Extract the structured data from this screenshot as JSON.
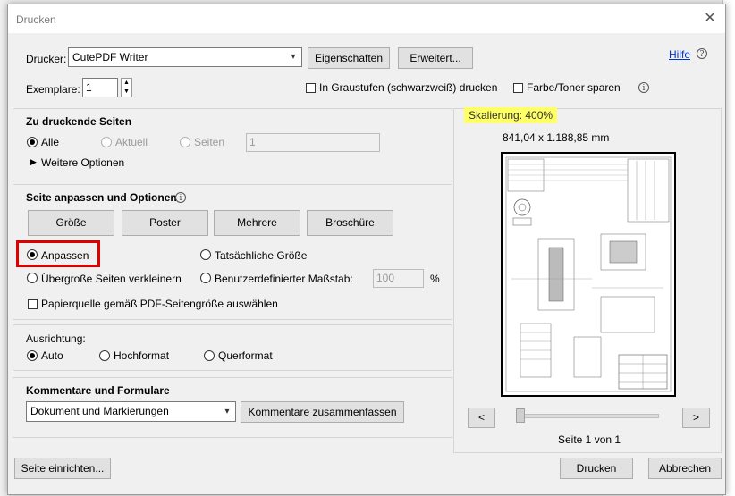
{
  "window": {
    "title": "Drucken"
  },
  "printer": {
    "label": "Drucker:",
    "value": "CutePDF Writer",
    "properties_btn": "Eigenschaften",
    "advanced_btn": "Erweitert...",
    "help_link": "Hilfe"
  },
  "copies": {
    "label": "Exemplare:",
    "value": "1",
    "grayscale_label": "In Graustufen (schwarzweiß) drucken",
    "save_toner_label": "Farbe/Toner sparen"
  },
  "pages": {
    "heading": "Zu druckende Seiten",
    "all": "Alle",
    "current": "Aktuell",
    "pages": "Seiten",
    "pages_value": "1",
    "more_options": "Weitere Optionen"
  },
  "fit": {
    "heading": "Seite anpassen und Optionen",
    "tabs": [
      "Größe",
      "Poster",
      "Mehrere",
      "Broschüre"
    ],
    "fit_label": "Anpassen",
    "actual_size": "Tatsächliche Größe",
    "shrink": "Übergroße Seiten verkleinern",
    "custom_scale": "Benutzerdefinierter Maßstab:",
    "custom_scale_value": "100",
    "percent": "%",
    "paper_source": "Papierquelle gemäß PDF-Seitengröße auswählen"
  },
  "orientation": {
    "label": "Ausrichtung:",
    "auto": "Auto",
    "portrait": "Hochformat",
    "landscape": "Querformat"
  },
  "comments": {
    "heading": "Kommentare und Formulare",
    "value": "Dokument und Markierungen",
    "summarize_btn": "Kommentare zusammenfassen"
  },
  "preview": {
    "scaling": "Skalierung: 400%",
    "size": "841,04 x 1.188,85 mm",
    "prev": "<",
    "next": ">",
    "page_status": "Seite 1 von 1"
  },
  "footer": {
    "page_setup_btn": "Seite einrichten...",
    "print_btn": "Drucken",
    "cancel_btn": "Abbrechen"
  },
  "colors": {
    "highlight": "#e00000",
    "scaling_bg": "#ffff66",
    "link": "#0033cc"
  }
}
